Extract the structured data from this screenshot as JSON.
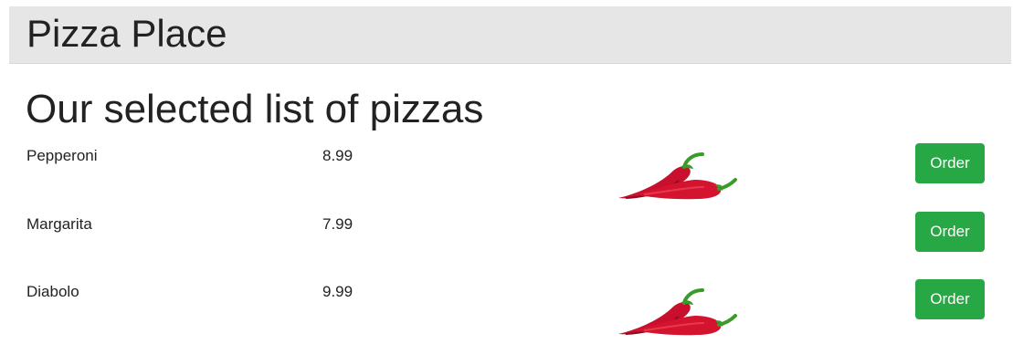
{
  "header": {
    "title": "Pizza Place"
  },
  "main": {
    "title": "Our selected list of pizzas",
    "order_label": "Order",
    "pizzas": [
      {
        "name": "Pepperoni",
        "price": "8.99",
        "spicy": true
      },
      {
        "name": "Margarita",
        "price": "7.99",
        "spicy": false
      },
      {
        "name": "Diabolo",
        "price": "9.99",
        "spicy": true
      }
    ]
  },
  "icons": {
    "spicy": "chili-pepper-icon"
  },
  "colors": {
    "header_bg": "#e6e6e6",
    "order_button": "#28a745",
    "chili_red": "#c8102e",
    "chili_stem": "#3a9a2a"
  }
}
